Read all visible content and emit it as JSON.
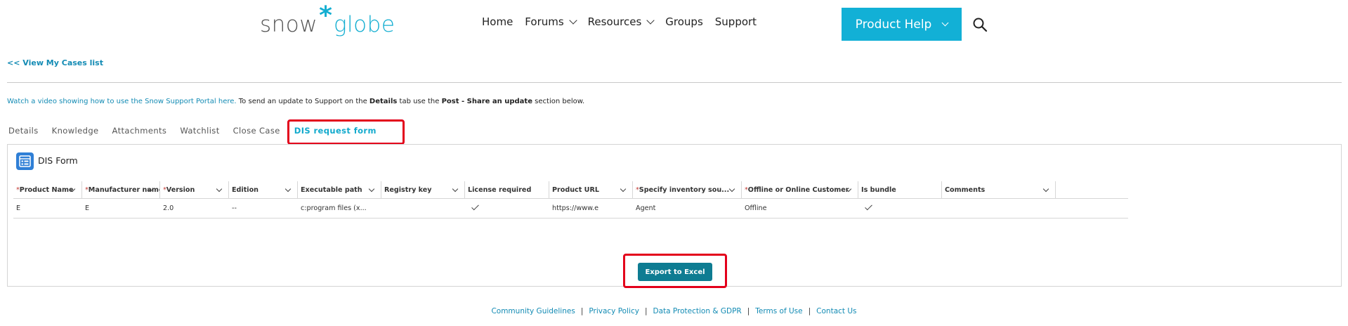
{
  "logo": {
    "left": "snow",
    "star": "*",
    "right": "globe"
  },
  "nav": {
    "items": [
      {
        "label": "Home",
        "dropdown": false
      },
      {
        "label": "Forums",
        "dropdown": true
      },
      {
        "label": "Resources",
        "dropdown": true
      },
      {
        "label": "Groups",
        "dropdown": false
      },
      {
        "label": "Support",
        "dropdown": false
      }
    ],
    "help_button": "Product Help",
    "search_icon": "search-icon"
  },
  "back_link": "<< View My Cases list",
  "info": {
    "link_text": "Watch a video showing how to use the Snow Support Portal here.",
    "text_1": " To send an update to Support on the ",
    "bold_1": "Details",
    "text_2": " tab use the ",
    "bold_2": "Post - Share an update",
    "text_3": " section below."
  },
  "tabs": [
    {
      "label": "Details",
      "active": false
    },
    {
      "label": "Knowledge",
      "active": false
    },
    {
      "label": "Attachments",
      "active": false
    },
    {
      "label": "Watchlist",
      "active": false
    },
    {
      "label": "Close Case",
      "active": false
    },
    {
      "label": "DIS request form",
      "active": true
    }
  ],
  "panel": {
    "title": "DIS Form",
    "icon": "form-icon"
  },
  "table": {
    "columns": [
      {
        "label": "Product Name",
        "required": true
      },
      {
        "label": "Manufacturer name",
        "required": true
      },
      {
        "label": "Version",
        "required": true
      },
      {
        "label": "Edition",
        "required": false
      },
      {
        "label": "Executable path",
        "required": false
      },
      {
        "label": "Registry key",
        "required": false
      },
      {
        "label": "License required",
        "required": false
      },
      {
        "label": "Product URL",
        "required": false
      },
      {
        "label": "Specify inventory sou...",
        "required": true
      },
      {
        "label": "Offline or Online Customer",
        "required": true
      },
      {
        "label": "Is bundle",
        "required": false
      },
      {
        "label": "Comments",
        "required": false
      }
    ],
    "rows": [
      {
        "product_name": "E",
        "manufacturer": "E",
        "version": "2.0",
        "edition": "--",
        "exec_path": "c:program files (x...",
        "registry_key": "",
        "license_required": true,
        "product_url": "https://www.e",
        "inventory_source": "Agent",
        "offline_online": "Offline",
        "is_bundle": true,
        "comments": ""
      }
    ]
  },
  "export_button": "Export to Excel",
  "footer": {
    "links": [
      "Community Guidelines",
      "Privacy Policy",
      "Data Protection & GDPR",
      "Terms of Use",
      "Contact Us"
    ],
    "separator": "|"
  },
  "colors": {
    "brand": "#12b0d6",
    "link": "#138bb4",
    "export_button": "#0e7c92",
    "highlight": "#e3001b"
  }
}
